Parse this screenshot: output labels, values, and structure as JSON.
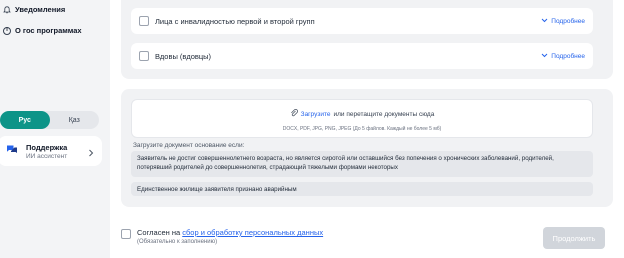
{
  "sidebar": {
    "notifications": "Уведомления",
    "about": "О гос программах",
    "language": {
      "options": [
        "Рус",
        "Қаз"
      ],
      "active": "Рус"
    },
    "support": {
      "title": "Поддержка",
      "subtitle": "ИИ ассистент"
    }
  },
  "categories": {
    "items": [
      {
        "label": "Лица с инвалидностью первой и второй групп",
        "more": "Подробнее"
      },
      {
        "label": "Вдовы (вдовцы)",
        "more": "Подробнее"
      }
    ]
  },
  "upload": {
    "link": "Загрузите",
    "text": "или перетащите документы сюда",
    "formats": "DOCX, PDF, JPG, PNG, JPEG (До 5 файлов. Каждый не более 5 мб)",
    "basis_label": "Загрузите документ основание если:",
    "reasons": [
      "Заявитель не достиг совершеннолетнего возраста, но является сиротой или оставшийся без попечения о хронических заболеваний, родителей, потерявший родителей до совершеннолетия, страдающий тяжелыми формами некоторых",
      "Единственное жилище заявителя признано аварийным"
    ]
  },
  "consent": {
    "prefix": "Согласен на",
    "link": "сбор и обработку персональных данных",
    "note": "(Обязательно к заполнению)"
  },
  "submit_label": "Продолжить",
  "colors": {
    "accent": "#0d9488",
    "link": "#2563eb",
    "disabled": "#d1d5db"
  }
}
